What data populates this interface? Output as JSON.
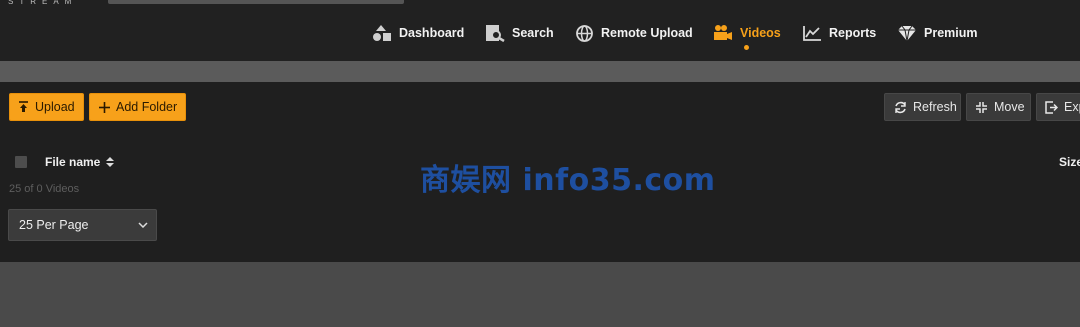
{
  "logo": {
    "text": "STREAM"
  },
  "nav": {
    "items": [
      {
        "label": "Dashboard",
        "icon": "dashboard-icon"
      },
      {
        "label": "Search",
        "icon": "search-icon"
      },
      {
        "label": "Remote Upload",
        "icon": "globe-icon"
      },
      {
        "label": "Videos",
        "icon": "video-camera-icon",
        "active": true
      },
      {
        "label": "Reports",
        "icon": "chart-line-icon"
      },
      {
        "label": "Premium",
        "icon": "diamond-icon"
      }
    ]
  },
  "toolbar": {
    "upload_label": "Upload",
    "add_folder_label": "Add Folder",
    "refresh_label": "Refresh",
    "move_label": "Move",
    "export_label": "Exp"
  },
  "table": {
    "columns": [
      "File name",
      "Size"
    ],
    "count_text": "25 of 0 Videos"
  },
  "pagination": {
    "per_page": "25 Per Page"
  },
  "watermark": {
    "text": "商娱网 info35.com"
  },
  "colors": {
    "accent": "#f7a11a",
    "background": "#1f1f1f",
    "topbar": "#212121",
    "watermark": "#1e4fa0"
  }
}
